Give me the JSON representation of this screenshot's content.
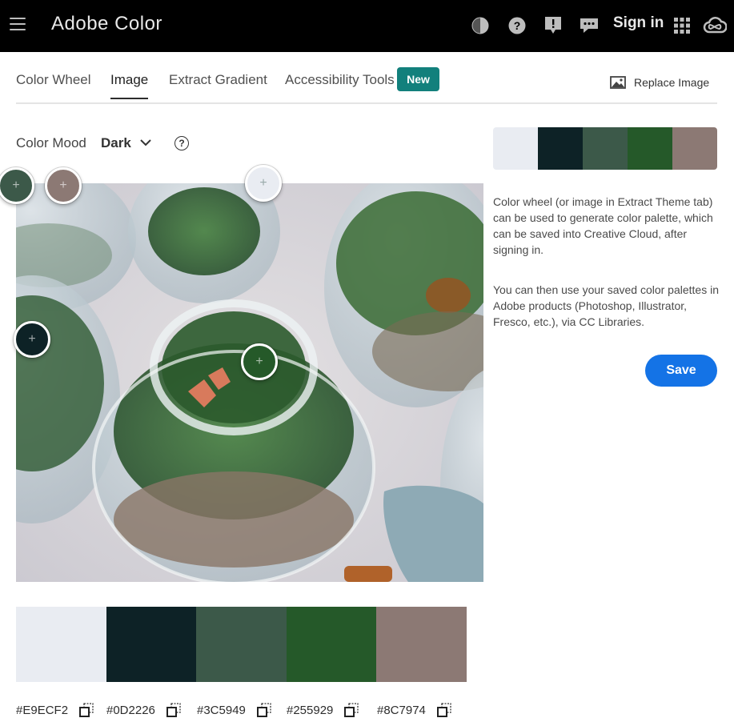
{
  "header": {
    "app_title": "Adobe Color",
    "sign_in": "Sign in",
    "icons": [
      "menu-icon",
      "dark-mode-icon",
      "help-icon",
      "feedback-icon",
      "chat-icon",
      "apps-grid-icon",
      "creative-cloud-icon"
    ]
  },
  "tabs": [
    {
      "label": "Color Wheel",
      "active": false
    },
    {
      "label": "Image",
      "active": true
    },
    {
      "label": "Extract Gradient",
      "active": false
    },
    {
      "label": "Accessibility Tools",
      "active": false
    }
  ],
  "new_badge": "New",
  "replace_image": "Replace Image",
  "mood": {
    "label": "Color Mood",
    "value": "Dark"
  },
  "palette": [
    {
      "hex": "#E9ECF2",
      "color": "#E9ECF2"
    },
    {
      "hex": "#0D2226",
      "color": "#0D2226"
    },
    {
      "hex": "#3C5949",
      "color": "#3C5949"
    },
    {
      "hex": "#255929",
      "color": "#255929"
    },
    {
      "hex": "#8C7974",
      "color": "#8C7974"
    }
  ],
  "description": {
    "paragraph1": "Color wheel (or image in Extract Theme tab) can be used to generate color palette, which can be saved into Creative Cloud, after signing in.",
    "paragraph2": "You can then use your saved color palettes in Adobe products (Photoshop, Illustrator, Fresco, etc.), via CC Libraries."
  },
  "save_label": "Save",
  "colors": {
    "accent_blue": "#1473e6",
    "badge_teal": "#12807c",
    "topbar": "#000000"
  }
}
